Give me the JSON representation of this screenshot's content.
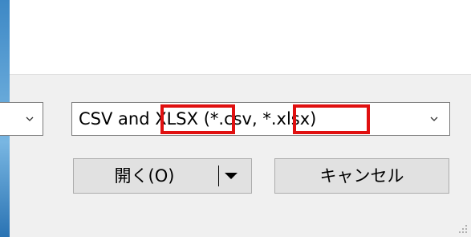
{
  "file_type_filter": {
    "prefix": "CSV and ",
    "highlight_xlsx": "XLSX",
    "middle": " (*.csv, ",
    "highlight_ext": "*.xlsx",
    "suffix": ")"
  },
  "buttons": {
    "open_label": "開く(O)",
    "cancel_label": "キャンセル"
  },
  "icons": {
    "dropdown": "chevron-down-icon",
    "split_arrow": "caret-down-icon",
    "resize": "resize-grip-icon"
  },
  "colors": {
    "highlight": "#e01010"
  }
}
